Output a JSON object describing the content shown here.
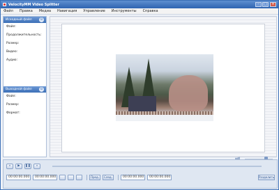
{
  "window": {
    "title": "VelocityMM Video Splitter",
    "controls": {
      "minimize": "–",
      "maximize": "□",
      "close": "×"
    }
  },
  "menu": [
    "Файл",
    "Правка",
    "Медиа",
    "Навигация",
    "Управление",
    "Инструменты",
    "Справка"
  ],
  "source_panel": {
    "title": "Исходный файл",
    "fields": [
      "Файл:",
      "Продолжительность:",
      "Размер:",
      "Видео:",
      "Аудио:"
    ]
  },
  "output_panel": {
    "title": "Выходной файл",
    "fields": [
      "Файл:",
      "Размер:",
      "Формат:"
    ]
  },
  "transport": {
    "rewind": "«",
    "play": "▶",
    "pause": "❚❚",
    "forward": "»"
  },
  "bottom": {
    "time_start": "00:00:00.000",
    "time_end": "00:00:00.000",
    "mark_in": "00:00:00.000",
    "mark_out": "00:00:00.000",
    "prev_label": "Пред.",
    "next_label": "След.",
    "split_label": "Разделить"
  },
  "icons": [
    "app-icon",
    "volume-icon",
    "panel-toggle-icon"
  ],
  "colors": {
    "accent": "#3b6fb6",
    "titlebar": "#2e63b0"
  }
}
